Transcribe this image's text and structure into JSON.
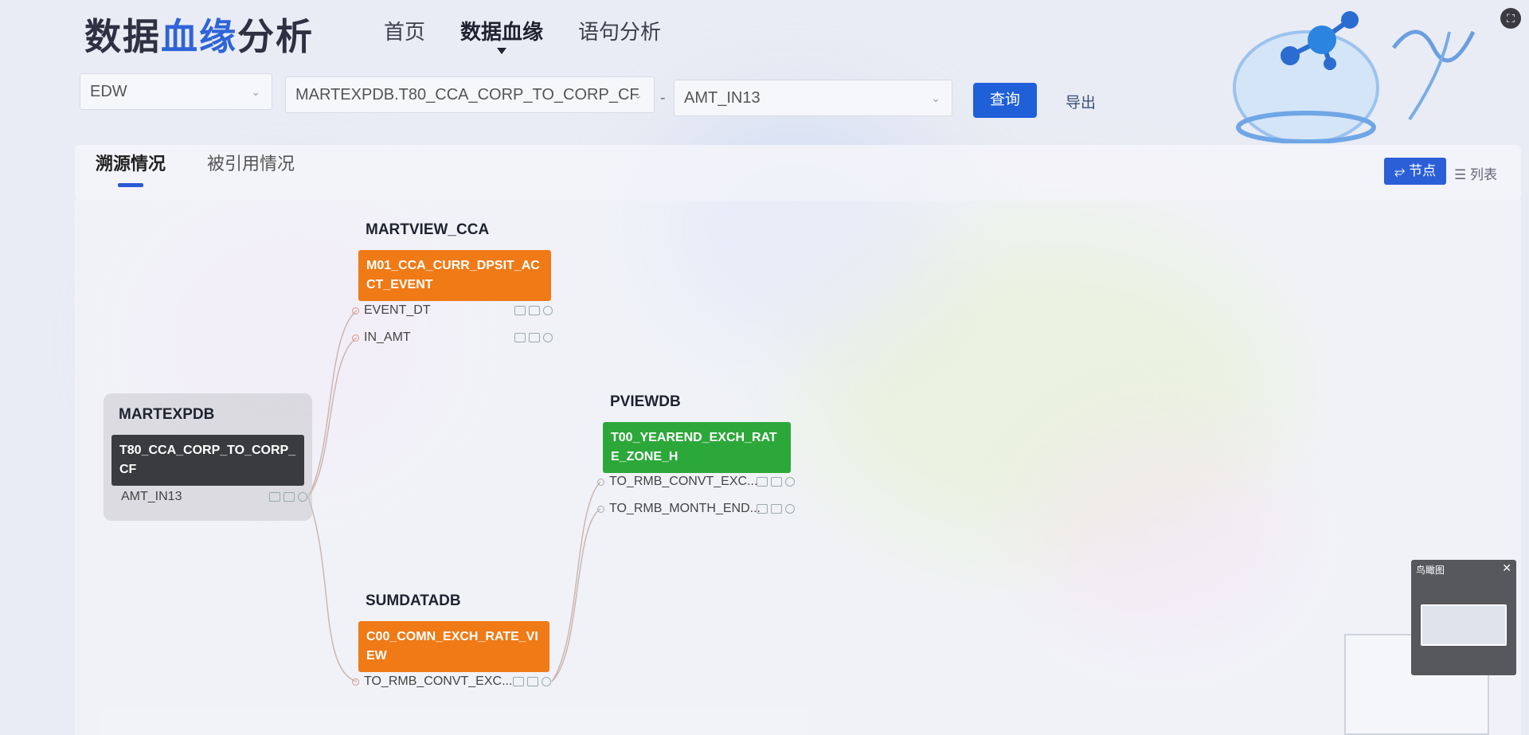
{
  "header": {
    "title_part1": "数据",
    "title_part2": "血缘",
    "title_part3": "分析",
    "nav": [
      "首页",
      "数据血缘",
      "语句分析"
    ]
  },
  "query": {
    "database": "EDW",
    "table": "MARTEXPDB.T80_CCA_CORP_TO_CORP_CF",
    "separator": "-",
    "column": "AMT_IN13",
    "query_label": "查询",
    "export_label": "导出"
  },
  "tabs": {
    "trace": "溯源情况",
    "referenced": "被引用情况"
  },
  "view_toggle": {
    "node": "节点",
    "list": "列表"
  },
  "graph": {
    "source": {
      "db": "MARTEXPDB",
      "table": "T80_CCA_CORP_TO_CORP_CF",
      "fields": [
        "AMT_IN13"
      ]
    },
    "upstream_1": {
      "db": "MARTVIEW_CCA",
      "table": "M01_CCA_CURR_DPSIT_ACCT_EVENT",
      "fields": [
        "EVENT_DT",
        "IN_AMT"
      ]
    },
    "upstream_2": {
      "db": "SUMDATADB",
      "table": "C00_COMN_EXCH_RATE_VIEW",
      "fields": [
        "TO_RMB_CONVT_EXC..."
      ]
    },
    "upstream_3": {
      "db": "PVIEWDB",
      "table": "T00_YEAREND_EXCH_RATE_ZONE_H",
      "fields": [
        "TO_RMB_CONVT_EXC...",
        "TO_RMB_MONTH_END..."
      ]
    }
  },
  "minimap": {
    "title": "鸟瞰图"
  },
  "colors": {
    "accent": "#2f64d8",
    "orange_node": "#f07a16",
    "green_node": "#2ca83a",
    "source_node": "#3a3b3e"
  }
}
